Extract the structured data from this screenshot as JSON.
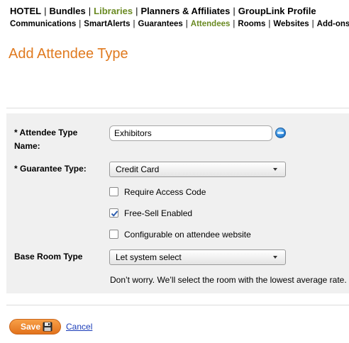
{
  "nav_primary": [
    {
      "label": "HOTEL",
      "active": false
    },
    {
      "label": "Bundles",
      "active": false
    },
    {
      "label": "Libraries",
      "active": true
    },
    {
      "label": "Planners & Affiliates",
      "active": false
    },
    {
      "label": "GroupLink Profile",
      "active": false
    }
  ],
  "nav_secondary": [
    {
      "label": "Communications",
      "active": false
    },
    {
      "label": "SmartAlerts",
      "active": false
    },
    {
      "label": "Guarantees",
      "active": false
    },
    {
      "label": "Attendees",
      "active": true
    },
    {
      "label": "Rooms",
      "active": false
    },
    {
      "label": "Websites",
      "active": false
    },
    {
      "label": "Add-ons",
      "active": false
    }
  ],
  "nav_separator": "|",
  "page_title": "Add Attendee Type",
  "form": {
    "attendee_type_label": "* Attendee Type Name:",
    "attendee_type_value": "Exhibitors",
    "guarantee_type_label": "* Guarantee Type:",
    "guarantee_type_selected": "Credit Card",
    "checkboxes": [
      {
        "label": "Require Access Code",
        "checked": false
      },
      {
        "label": "Free-Sell Enabled",
        "checked": true
      },
      {
        "label": "Configurable on attendee website",
        "checked": false
      }
    ],
    "base_room_label": "Base Room Type",
    "base_room_selected": "Let system select",
    "base_room_note": "Don’t worry. We’ll select the room with the lowest average rate."
  },
  "actions": {
    "save_label": "Save",
    "cancel_label": "Cancel"
  },
  "colors": {
    "accent_orange": "#e07a1f",
    "active_nav_green": "#6a8a22",
    "link_blue": "#1a3cb8",
    "panel_gray": "#f0f0f0"
  },
  "icons": {
    "help": "help-icon",
    "save": "floppy-disk-icon",
    "dropdown": "chevron-down-icon",
    "checkmark": "checkmark-icon"
  }
}
